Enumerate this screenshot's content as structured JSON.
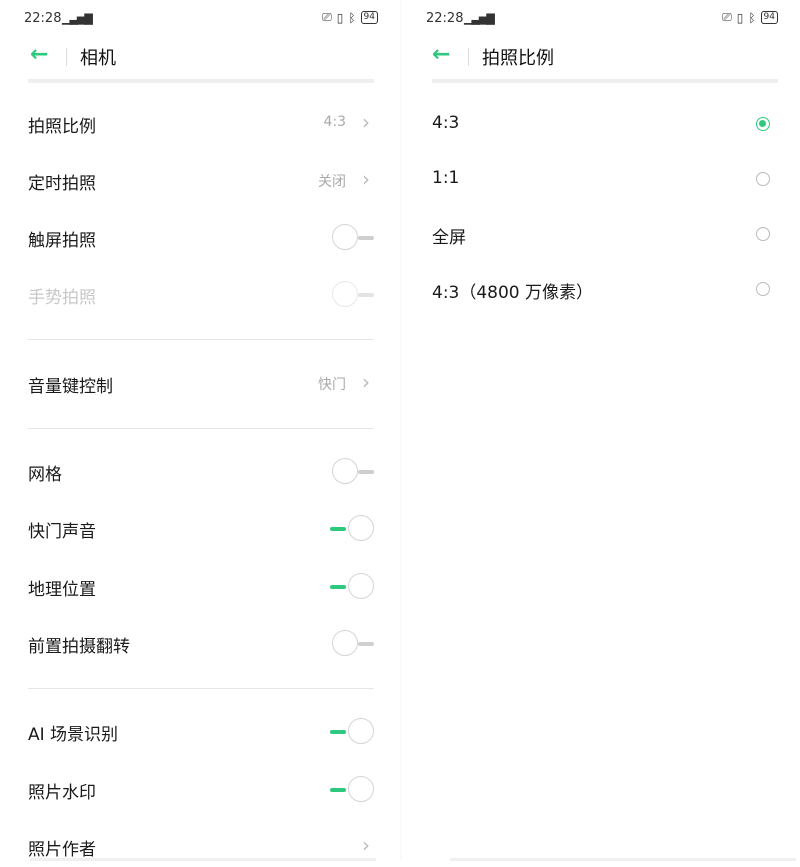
{
  "left": {
    "status": {
      "time": "22:28",
      "signal": "4G",
      "battery": "94"
    },
    "title": "相机",
    "rows": [
      {
        "label": "拍照比例",
        "value": "4:3"
      },
      {
        "label": "定时拍照",
        "value": "关闭"
      },
      {
        "label": "触屏拍照",
        "toggle": "off"
      },
      {
        "label": "手势拍照",
        "toggle": "off",
        "disabled": true
      },
      {
        "label": "音量键控制",
        "value": "快门"
      },
      {
        "label": "网格",
        "toggle": "off"
      },
      {
        "label": "快门声音",
        "toggle": "on"
      },
      {
        "label": "地理位置",
        "toggle": "on"
      },
      {
        "label": "前置拍摄翻转",
        "toggle": "off"
      },
      {
        "label": "AI 场景识别",
        "toggle": "on"
      },
      {
        "label": "照片水印",
        "toggle": "on"
      },
      {
        "label": "照片作者"
      }
    ]
  },
  "right": {
    "status": {
      "time": "22:28",
      "signal": "4G",
      "battery": "94"
    },
    "title": "拍照比例",
    "options": [
      {
        "label": "4:3",
        "selected": true
      },
      {
        "label": "1:1",
        "selected": false
      },
      {
        "label": "全屏",
        "selected": false
      },
      {
        "label": "4:3（4800 万像素）",
        "selected": false
      }
    ]
  },
  "colors": {
    "accent": "#2ec97e"
  }
}
